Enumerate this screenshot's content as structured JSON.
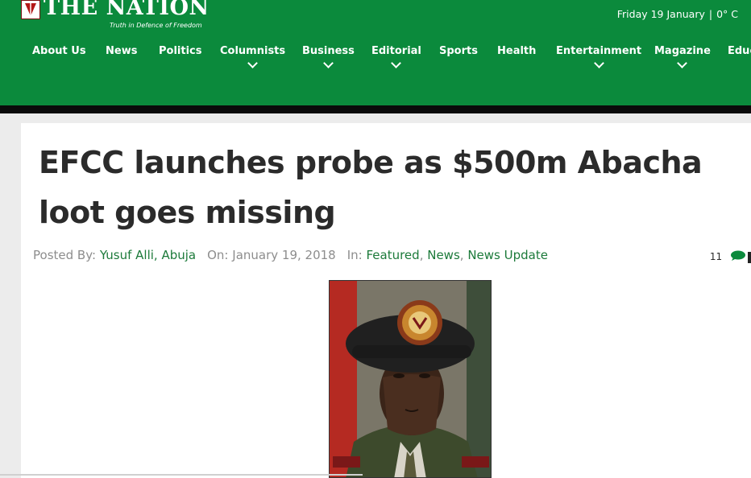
{
  "header": {
    "logo_title": "THE NATION",
    "logo_tagline": "Truth in Defence of Freedom",
    "date": "Friday 19 January",
    "weather": "0° C",
    "colors": {
      "brand_green": "#0b8a3c",
      "bar_black": "#0a0a0a",
      "link_green": "#1c7a3a"
    }
  },
  "nav": {
    "items": [
      {
        "label": "About Us",
        "has_dropdown": false
      },
      {
        "label": "News",
        "has_dropdown": false
      },
      {
        "label": "Politics",
        "has_dropdown": false
      },
      {
        "label": "Columnists",
        "has_dropdown": true
      },
      {
        "label": "Business",
        "has_dropdown": true
      },
      {
        "label": "Editorial",
        "has_dropdown": true
      },
      {
        "label": "Sports",
        "has_dropdown": false
      },
      {
        "label": "Health",
        "has_dropdown": false
      },
      {
        "label": "Entertainment",
        "has_dropdown": true
      },
      {
        "label": "Magazine",
        "has_dropdown": true
      },
      {
        "label": "Educ",
        "has_dropdown": false
      }
    ]
  },
  "article": {
    "headline": "EFCC launches probe as $500m Abacha loot goes missing",
    "posted_by_label": "Posted By:",
    "author": "Yusuf Alli, Abuja",
    "on_label": "On:",
    "date": "January 19, 2018",
    "in_label": "In:",
    "categories": [
      "Featured",
      "News",
      "News Update"
    ],
    "comment_count": "11",
    "comment_icon": "speech-bubble-icon"
  }
}
